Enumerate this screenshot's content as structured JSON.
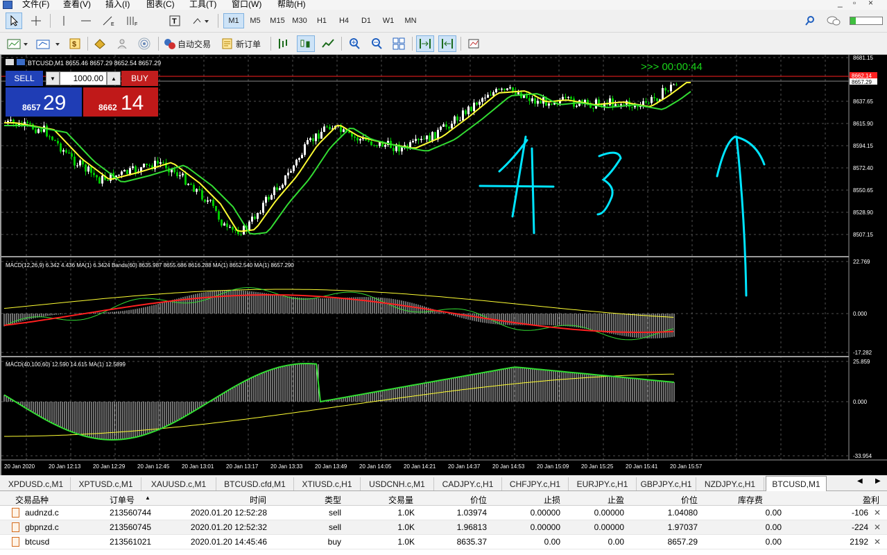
{
  "menu": {
    "items": [
      "文件(F)",
      "查看(V)",
      "插入(I)",
      "图表(C)",
      "工具(T)",
      "窗口(W)",
      "帮助(H)"
    ],
    "window_controls": [
      "_",
      "▫",
      "×"
    ]
  },
  "toolbar": {
    "timeframes": [
      "M1",
      "M5",
      "M15",
      "M30",
      "H1",
      "H4",
      "D1",
      "W1",
      "MN"
    ],
    "active_timeframe": "M1",
    "auto_trading_label": "自动交易",
    "new_order_label": "新订单"
  },
  "chart": {
    "header": "BTCUSD,M1  8655.46 8657.29 8652.54 8657.29",
    "timer": ">>> 00:00:44",
    "price_scale": [
      "8681.15",
      "8657.29",
      "8637.65",
      "8615.90",
      "8594.15",
      "8572.40",
      "8550.65",
      "8528.90",
      "8507.15"
    ],
    "ask_tag": "8662.14",
    "bid_tag": "8657.29",
    "macd1_label": "MACD(12,26,9) 6.342 4.436 MA(1) 6.3424 Bands(60) 8635.987 8655.686 8616.288 MA(1) 8652.540 MA(1) 8657.290",
    "macd1_scale": [
      "22.769",
      "0.000",
      "-17.282"
    ],
    "macd2_label": "MACD(40,100,60) 12.590 14.615 MA(1) 12.5899",
    "macd2_scale": [
      "25.859",
      "0.000",
      "-33.954"
    ],
    "time_axis": [
      "20 Jan 2020",
      "20 Jan 12:13",
      "20 Jan 12:29",
      "20 Jan 12:45",
      "20 Jan 13:01",
      "20 Jan 13:17",
      "20 Jan 13:33",
      "20 Jan 13:49",
      "20 Jan 14:05",
      "20 Jan 14:21",
      "20 Jan 14:37",
      "20 Jan 14:53",
      "20 Jan 15:09",
      "20 Jan 15:25",
      "20 Jan 15:41",
      "20 Jan 15:57"
    ],
    "colors": {
      "up": "#ffffff",
      "down": "#00c800",
      "ma_fast": "#ffff33",
      "ma_slow": "#33dd33",
      "signal": "#ff2020",
      "grid": "#505050",
      "annotation": "#00e5ff"
    }
  },
  "trade_panel": {
    "sell_label": "SELL",
    "buy_label": "BUY",
    "lot": "1000.00",
    "sell_small": "8657",
    "sell_big": "29",
    "buy_small": "8662",
    "buy_big": "14"
  },
  "tabs": [
    "XPDUSD.c,M1",
    "XPTUSD.c,M1",
    "XAUUSD.c,M1",
    "BTCUSD.cfd,M1",
    "XTIUSD.c,H1",
    "USDCNH.c,M1",
    "CADJPY.c,H1",
    "CHFJPY.c,H1",
    "EURJPY.c,H1",
    "GBPJPY.c,H1",
    "NZDJPY.c,H1",
    "BTCUSD,M1"
  ],
  "active_tab": "BTCUSD,M1",
  "terminal": {
    "headers": [
      "交易品种",
      "订单号",
      "时间",
      "类型",
      "交易量",
      "价位",
      "止损",
      "止盈",
      "价位",
      "库存费",
      "盈利"
    ],
    "rows": [
      [
        "audnzd.c",
        "213560744",
        "2020.01.20 12:52:28",
        "sell",
        "1.0K",
        "1.03974",
        "0.00000",
        "0.00000",
        "1.04080",
        "0.00",
        "-106"
      ],
      [
        "gbpnzd.c",
        "213560745",
        "2020.01.20 12:52:32",
        "sell",
        "1.0K",
        "1.96813",
        "0.00000",
        "0.00000",
        "1.97037",
        "0.00",
        "-224"
      ],
      [
        "btcusd",
        "213561021",
        "2020.01.20 14:45:46",
        "buy",
        "1.0K",
        "8635.37",
        "0.00",
        "0.00",
        "8657.29",
        "0.00",
        "2192"
      ]
    ]
  }
}
